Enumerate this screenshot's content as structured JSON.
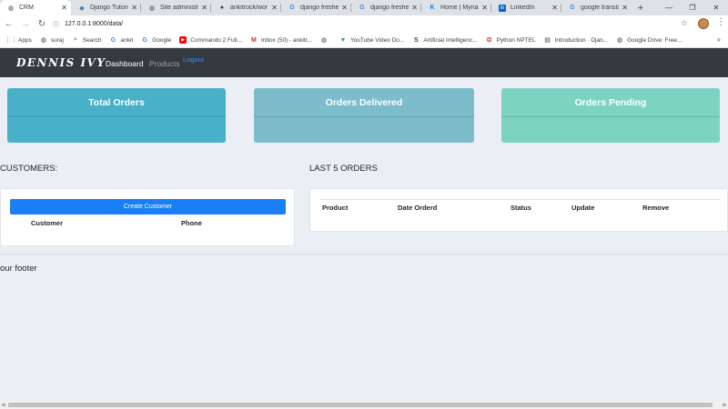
{
  "browser": {
    "tabs": [
      {
        "title": "CRM",
        "icon": "globe-icon",
        "active": true
      },
      {
        "title": "Django Tutoria",
        "icon": "django-icon"
      },
      {
        "title": "Site administra",
        "icon": "globe-icon"
      },
      {
        "title": "ankitrock/wor",
        "icon": "github-icon"
      },
      {
        "title": "django fresher",
        "icon": "google-icon"
      },
      {
        "title": "django fresher",
        "icon": "google-icon"
      },
      {
        "title": "Home | Mynaa",
        "icon": "k-icon"
      },
      {
        "title": "LinkedIn",
        "icon": "linkedin-icon"
      },
      {
        "title": "google transla",
        "icon": "google-icon"
      }
    ],
    "url": "127.0.0.1:8000/data/",
    "bookmarks": [
      {
        "label": "Apps",
        "icon": "apps-icon"
      },
      {
        "label": "suraj",
        "icon": "globe-icon"
      },
      {
        "label": "Search",
        "icon": "search-icon"
      },
      {
        "label": "ankit",
        "icon": "google-icon"
      },
      {
        "label": "Google",
        "icon": "google-icon"
      },
      {
        "label": "Commando 2 Full...",
        "icon": "youtube-icon"
      },
      {
        "label": "Inbox (50) - ankitr...",
        "icon": "gmail-icon"
      },
      {
        "label": "",
        "icon": "globe-icon"
      },
      {
        "label": "YouTube Video Do...",
        "icon": "download-icon"
      },
      {
        "label": "Artificial Intelligenc...",
        "icon": "s-icon"
      },
      {
        "label": "Python NPTEL",
        "icon": "python-icon"
      },
      {
        "label": "Introduction · Djan...",
        "icon": "book-icon"
      },
      {
        "label": "Google Drive: Free...",
        "icon": "globe-icon"
      }
    ]
  },
  "navbar": {
    "brand": "DENNIS IVY",
    "links": [
      "Dashboard",
      "Products"
    ],
    "logout": "Logout"
  },
  "cards": {
    "total": "Total Orders",
    "delivered": "Orders Delivered",
    "pending": "Orders Pending"
  },
  "customers": {
    "heading": "CUSTOMERS:",
    "button": "Create Customer",
    "columns": [
      "Customer",
      "Phone"
    ]
  },
  "orders": {
    "heading": "LAST 5 ORDERS",
    "columns": [
      "Product",
      "Date Orderd",
      "Status",
      "Update",
      "Remove"
    ]
  },
  "footer": "our footer",
  "colors": {
    "navbar": "#343a40",
    "card_total": "#49b0c9",
    "card_delivered": "#7cbccb",
    "card_pending": "#7dd3c2",
    "primary_button": "#1a7ff5",
    "page_background": "#ebeef4"
  }
}
